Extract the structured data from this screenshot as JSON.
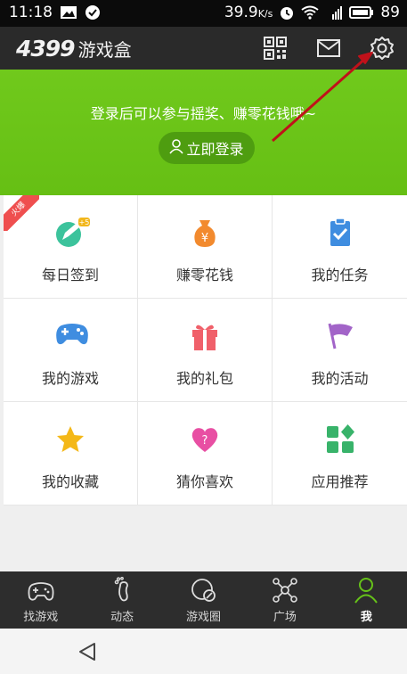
{
  "status_bar": {
    "time": "11:18",
    "battery_info": "39.9",
    "battery_unit": "K/s",
    "signal": "3G",
    "battery_level": "89"
  },
  "app_bar": {
    "logo_number": "4399",
    "logo_text": "游戏盒"
  },
  "hero": {
    "message": "登录后可以参与摇奖、赚零花钱哦~",
    "login_button": "立即登录"
  },
  "hot_badge": "火爆",
  "grid": {
    "items": [
      {
        "label": "每日签到",
        "badge": "+5"
      },
      {
        "label": "赚零花钱",
        "icon_text": "¥"
      },
      {
        "label": "我的任务"
      },
      {
        "label": "我的游戏"
      },
      {
        "label": "我的礼包"
      },
      {
        "label": "我的活动"
      },
      {
        "label": "我的收藏"
      },
      {
        "label": "猜你喜欢",
        "icon_text": "?"
      },
      {
        "label": "应用推荐"
      }
    ]
  },
  "bottom_nav": {
    "tabs": [
      {
        "label": "找游戏"
      },
      {
        "label": "动态"
      },
      {
        "label": "游戏圈"
      },
      {
        "label": "广场"
      },
      {
        "label": "我"
      }
    ]
  },
  "colors": {
    "accent_green": "#66bf14",
    "app_bar": "#2a2a2a",
    "annotation_arrow": "#c0111a"
  }
}
